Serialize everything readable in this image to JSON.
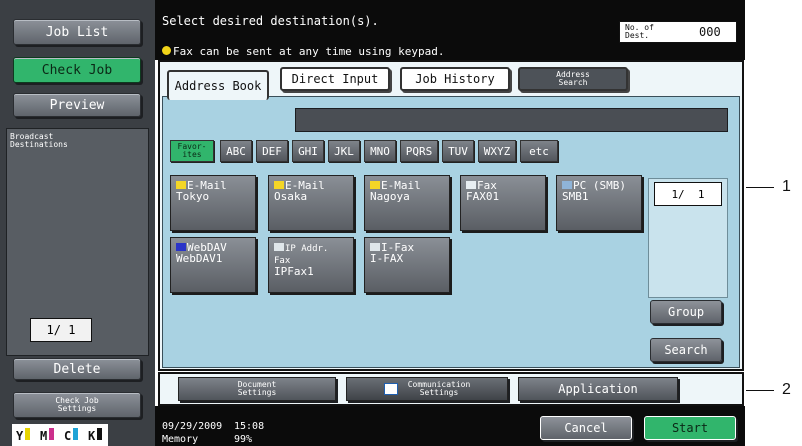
{
  "sidebar": {
    "job_list": "Job List",
    "check_job": "Check Job",
    "preview": "Preview",
    "broadcast_heading": "Broadcast\nDestinations",
    "page_counter": "1/ 1",
    "delete": "Delete",
    "check_job_settings": "Check Job\nSettings",
    "toner": [
      "Y",
      "M",
      "C",
      "K"
    ]
  },
  "header": {
    "instruction": "Select desired destination(s).",
    "fax_note": "Fax can be sent at any time using keypad.",
    "dest_count_label": "No. of\nDest.",
    "dest_count_value": "000"
  },
  "tabs": {
    "address_book": "Address Book",
    "direct_input": "Direct Input",
    "job_history": "Job History",
    "address_search": "Address\nSearch"
  },
  "index_keys": [
    "Favor-\nites",
    "ABC",
    "DEF",
    "GHI",
    "JKL",
    "MNO",
    "PQRS",
    "TUV",
    "WXYZ",
    "etc"
  ],
  "destinations": [
    {
      "type": "E-Mail",
      "name": "Tokyo",
      "icon": "envelope-icon"
    },
    {
      "type": "E-Mail",
      "name": "Osaka",
      "icon": "envelope-icon"
    },
    {
      "type": "E-Mail",
      "name": "Nagoya",
      "icon": "envelope-icon"
    },
    {
      "type": "Fax",
      "name": "FAX01",
      "icon": "fax-icon"
    },
    {
      "type": "PC (SMB)",
      "name": "SMB1",
      "icon": "pc-icon"
    },
    {
      "type": "WebDAV",
      "name": "WebDAV1",
      "icon": "webdav-icon"
    },
    {
      "type": "IP Addr.\nFax",
      "name": "IPFax1",
      "icon": "ipfax-icon"
    },
    {
      "type": "I-Fax",
      "name": "I-FAX",
      "icon": "ifax-icon"
    }
  ],
  "page_indicator": "1/  1",
  "group_button": "Group",
  "search_button": "Search",
  "bottom_tabs": {
    "document_settings": "Document\nSettings",
    "communication_settings": "Communication\nSettings",
    "application": "Application"
  },
  "footer": {
    "date": "09/29/2009",
    "time": "15:08",
    "memory_label": "Memory",
    "memory_value": "99%",
    "cancel": "Cancel",
    "start": "Start"
  },
  "callouts": [
    "1",
    "2"
  ],
  "colors": {
    "panel_bg": "#a9d2e2",
    "active_green": "#31b56c",
    "sidebar_bg": "#3b3f44"
  }
}
